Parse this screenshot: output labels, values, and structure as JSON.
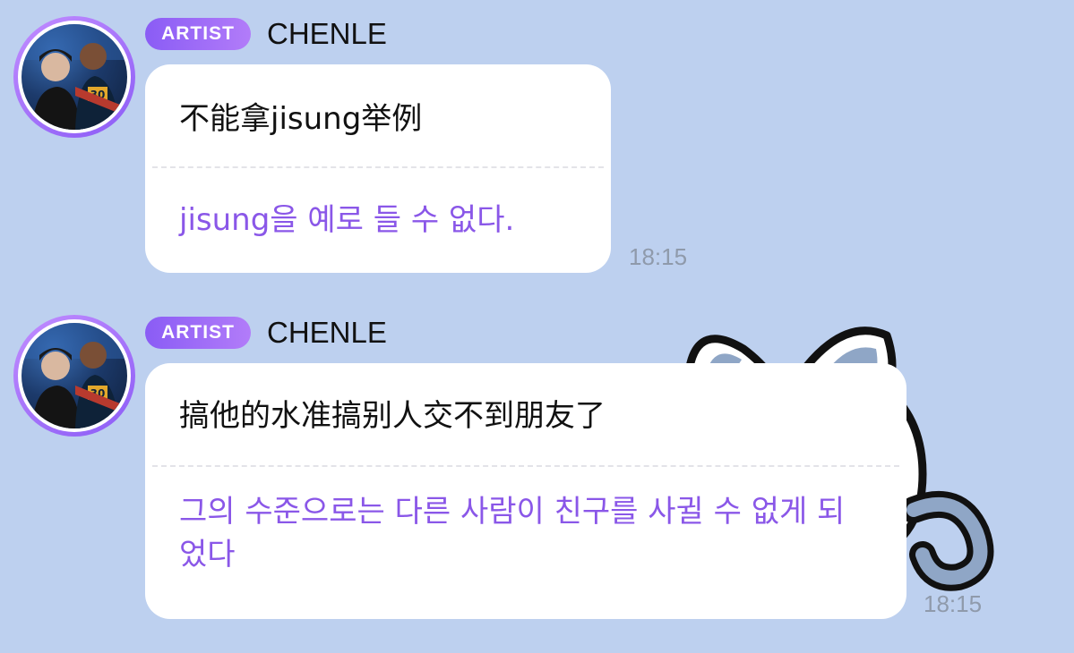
{
  "messages": [
    {
      "badge": "ARTIST",
      "sender": "CHENLE",
      "original": "不能拿jisung举例",
      "translation": "jisung을 예로 들 수 없다.",
      "time": "18:15"
    },
    {
      "badge": "ARTIST",
      "sender": "CHENLE",
      "original": "搞他的水准搞别人交不到朋友了",
      "translation": "그의 수준으로는 다른 사람이 친구를 사귈 수 없게 되었다",
      "time": "18:15"
    }
  ],
  "colors": {
    "background": "#bdd0ef",
    "accent": "#8a5cf5",
    "translation_text": "#8a57e8",
    "timestamp": "#8f9aab"
  },
  "icons": {
    "sticker": "white-cat-sticker-icon"
  }
}
